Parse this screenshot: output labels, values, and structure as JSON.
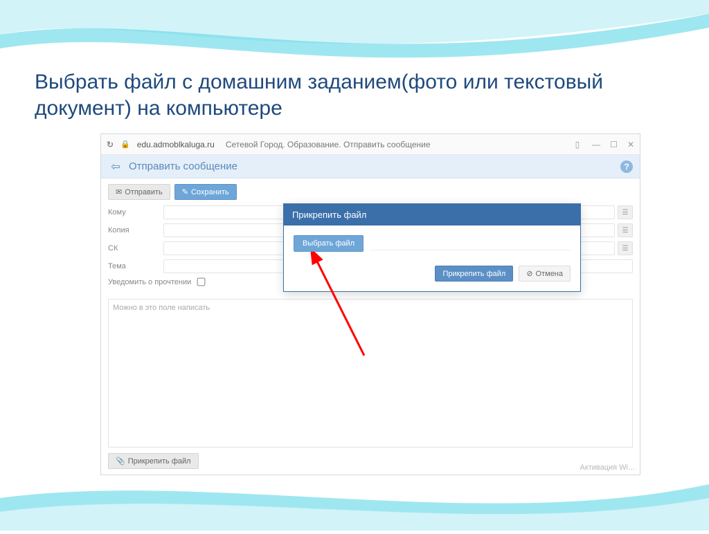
{
  "slide": {
    "title": "Выбрать файл с домашним заданием(фото или текстовый документ) на компьютере"
  },
  "browser": {
    "url_host": "edu.admoblkaluga.ru",
    "url_title": "Сетевой Город. Образование. Отправить сообщение"
  },
  "app": {
    "header": "Отправить сообщение",
    "send_label": "Отправить",
    "save_label": "Сохранить"
  },
  "form": {
    "to_label": "Кому",
    "cc_label": "Копия",
    "bcc_label": "СК",
    "subject_label": "Тема",
    "notify_label": "Уведомить о прочтении",
    "body_placeholder": "Можно в это поле написать",
    "attach_label": "Прикрепить файл"
  },
  "modal": {
    "title": "Прикрепить файл",
    "choose_label": "Выбрать файл",
    "attach_label": "Прикрепить файл",
    "cancel_label": "Отмена"
  },
  "footer": {
    "activation": "Активация Wi…"
  }
}
